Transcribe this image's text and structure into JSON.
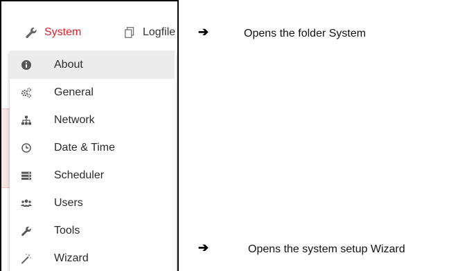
{
  "topbar": {
    "system_label": "System",
    "logfile_label": "Logfile"
  },
  "menu": {
    "items": [
      {
        "label": "About",
        "icon": "info-icon",
        "active": true
      },
      {
        "label": "General",
        "icon": "gears-icon",
        "active": false
      },
      {
        "label": "Network",
        "icon": "sitemap-icon",
        "active": false
      },
      {
        "label": "Date & Time",
        "icon": "clock-icon",
        "active": false
      },
      {
        "label": "Scheduler",
        "icon": "server-icon",
        "active": false
      },
      {
        "label": "Users",
        "icon": "users-icon",
        "active": false
      },
      {
        "label": "Tools",
        "icon": "wrench-icon",
        "active": false
      },
      {
        "label": "Wizard",
        "icon": "magic-wand-icon",
        "active": false
      }
    ]
  },
  "annotations": {
    "arrow_symbol": "➔",
    "system_note": "Opens the folder System",
    "wizard_note": "Opens the system setup Wizard"
  },
  "colors": {
    "accent": "#e0202a",
    "active_bg": "#ececec",
    "icon": "#555555"
  }
}
